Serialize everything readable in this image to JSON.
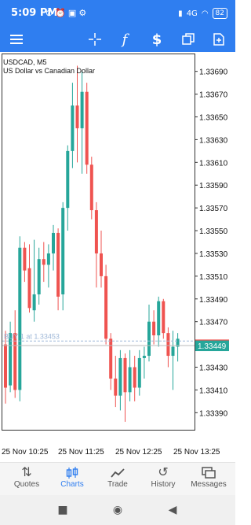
{
  "status_bar": {
    "time": "5:09 PM",
    "left_icons": [
      "signal-off-icon",
      "alarm-icon",
      "image-icon",
      "gear-icon"
    ],
    "network": "4G",
    "battery": "82"
  },
  "toolbar": {
    "icons": [
      "menu-icon",
      "crosshair-icon",
      "function-icon",
      "dollar-timeframe-icon",
      "window-icon",
      "add-chart-icon"
    ],
    "labels": {
      "function": "f",
      "dollar": "$"
    }
  },
  "chart": {
    "symbol": "USDCAD, M5",
    "description": "US Dollar vs Canadian Dollar",
    "trade_line_label": "BUY 1 at 1.33453",
    "current_price": "1.33449",
    "colors": {
      "bull": "#26a69a",
      "bear": "#ef5350",
      "price_badge": "#26a69a",
      "trade_line": "#9fb8d8"
    }
  },
  "chart_data": {
    "type": "candlestick",
    "symbol": "USDCAD",
    "timeframe": "M5",
    "ylim": [
      1.33375,
      1.33705
    ],
    "y_ticks": [
      "1.33690",
      "1.33670",
      "1.33650",
      "1.33630",
      "1.33610",
      "1.33590",
      "1.33570",
      "1.33550",
      "1.33530",
      "1.33510",
      "1.33490",
      "1.33470",
      "1.33430",
      "1.33410",
      "1.33390"
    ],
    "x_labels": [
      "25 Nov 10:25",
      "25 Nov 11:25",
      "25 Nov 12:25",
      "25 Nov 13:25"
    ],
    "trade_levels": [
      {
        "label": "BUY 1 at 1.33453",
        "price": 1.33453
      }
    ],
    "current_price": 1.33449,
    "candles": [
      {
        "o": 1.3345,
        "h": 1.33462,
        "l": 1.33398,
        "c": 1.33412
      },
      {
        "o": 1.33414,
        "h": 1.3347,
        "l": 1.33408,
        "c": 1.3346
      },
      {
        "o": 1.3346,
        "h": 1.3348,
        "l": 1.33403,
        "c": 1.3341
      },
      {
        "o": 1.3341,
        "h": 1.33545,
        "l": 1.334,
        "c": 1.33535
      },
      {
        "o": 1.33535,
        "h": 1.3354,
        "l": 1.33505,
        "c": 1.33515
      },
      {
        "o": 1.33517,
        "h": 1.33538,
        "l": 1.33478,
        "c": 1.33482
      },
      {
        "o": 1.3348,
        "h": 1.33542,
        "l": 1.3347,
        "c": 1.33494
      },
      {
        "o": 1.33494,
        "h": 1.33535,
        "l": 1.33485,
        "c": 1.33525
      },
      {
        "o": 1.33525,
        "h": 1.3354,
        "l": 1.33505,
        "c": 1.3352
      },
      {
        "o": 1.3352,
        "h": 1.33538,
        "l": 1.335,
        "c": 1.3353
      },
      {
        "o": 1.3353,
        "h": 1.33555,
        "l": 1.33515,
        "c": 1.33548
      },
      {
        "o": 1.33548,
        "h": 1.33552,
        "l": 1.3348,
        "c": 1.33492
      },
      {
        "o": 1.33494,
        "h": 1.33575,
        "l": 1.3348,
        "c": 1.3357
      },
      {
        "o": 1.3357,
        "h": 1.33625,
        "l": 1.3355,
        "c": 1.3362
      },
      {
        "o": 1.3362,
        "h": 1.3368,
        "l": 1.33605,
        "c": 1.3366
      },
      {
        "o": 1.3366,
        "h": 1.33695,
        "l": 1.3361,
        "c": 1.3364
      },
      {
        "o": 1.3364,
        "h": 1.3369,
        "l": 1.336,
        "c": 1.33672
      },
      {
        "o": 1.33672,
        "h": 1.3368,
        "l": 1.336,
        "c": 1.33608
      },
      {
        "o": 1.33608,
        "h": 1.33615,
        "l": 1.3356,
        "c": 1.33568
      },
      {
        "o": 1.33568,
        "h": 1.33575,
        "l": 1.335,
        "c": 1.3353
      },
      {
        "o": 1.3353,
        "h": 1.3355,
        "l": 1.335,
        "c": 1.3351
      },
      {
        "o": 1.3351,
        "h": 1.3352,
        "l": 1.3345,
        "c": 1.33455
      },
      {
        "o": 1.33455,
        "h": 1.3346,
        "l": 1.3341,
        "c": 1.3342
      },
      {
        "o": 1.3342,
        "h": 1.3344,
        "l": 1.33395,
        "c": 1.33405
      },
      {
        "o": 1.33405,
        "h": 1.33445,
        "l": 1.33392,
        "c": 1.33438
      },
      {
        "o": 1.33438,
        "h": 1.33442,
        "l": 1.33382,
        "c": 1.33408
      },
      {
        "o": 1.33408,
        "h": 1.33445,
        "l": 1.334,
        "c": 1.3343
      },
      {
        "o": 1.3343,
        "h": 1.3344,
        "l": 1.334,
        "c": 1.33412
      },
      {
        "o": 1.33412,
        "h": 1.33445,
        "l": 1.33405,
        "c": 1.33438
      },
      {
        "o": 1.33438,
        "h": 1.33448,
        "l": 1.3342,
        "c": 1.3344
      },
      {
        "o": 1.3344,
        "h": 1.33485,
        "l": 1.33435,
        "c": 1.3347
      },
      {
        "o": 1.3347,
        "h": 1.3348,
        "l": 1.3345,
        "c": 1.33458
      },
      {
        "o": 1.33458,
        "h": 1.33492,
        "l": 1.33448,
        "c": 1.33488
      },
      {
        "o": 1.33488,
        "h": 1.3349,
        "l": 1.33455,
        "c": 1.3346
      },
      {
        "o": 1.3346,
        "h": 1.33465,
        "l": 1.3343,
        "c": 1.3344
      },
      {
        "o": 1.3344,
        "h": 1.33462,
        "l": 1.3341,
        "c": 1.33448
      },
      {
        "o": 1.33448,
        "h": 1.3346,
        "l": 1.33435,
        "c": 1.33455
      }
    ]
  },
  "bottom_nav": {
    "items": [
      {
        "label": "Quotes",
        "icon": "quotes-icon",
        "active": false
      },
      {
        "label": "Charts",
        "icon": "charts-icon",
        "active": true
      },
      {
        "label": "Trade",
        "icon": "trade-icon",
        "active": false
      },
      {
        "label": "History",
        "icon": "history-icon",
        "active": false
      },
      {
        "label": "Messages",
        "icon": "messages-icon",
        "active": false
      }
    ]
  },
  "system_nav": {
    "icons": [
      "recents-icon",
      "home-icon",
      "back-icon"
    ]
  }
}
